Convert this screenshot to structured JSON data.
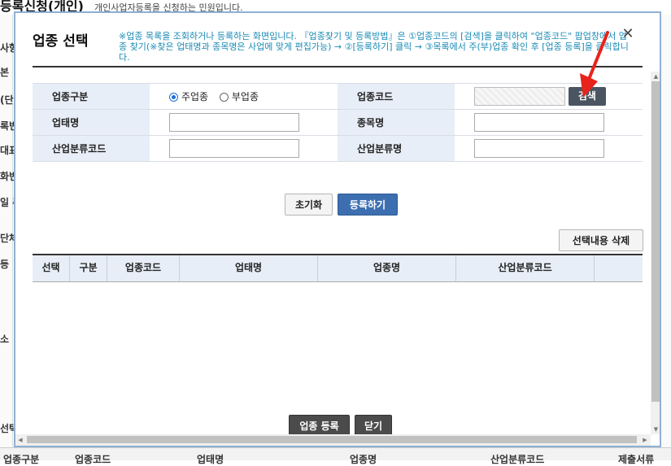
{
  "background": {
    "title": "등록신청(개인)",
    "subtitle": "개인사업자등록을 신청하는 민원입니다.",
    "left_labels": [
      "사항",
      "본",
      "(단",
      "록번",
      "대표",
      "화번",
      "일 주",
      "단체",
      "등",
      "소",
      "선택"
    ],
    "bottom_labels": [
      "업종구분",
      "업종코드",
      "업태명",
      "업종명",
      "산업분류코드",
      "제출서류"
    ]
  },
  "modal": {
    "title": "업종 선택",
    "notice": "※업종 목록을 조회하거나 등록하는 화면입니다. 『업종찾기 및 등록방법』은 ①업종코드의 [검색]을 클릭하여 \"업종코드\" 팝업창에서 업종 찾기(※찾은 업태명과 종목명은 사업에 맞게 편집가능) → ②[등록하기] 클릭 → ③목록에서 주(부)업종 확인 후 [업종 등록]을 클릭합니다.",
    "close_icon": "✕",
    "form": {
      "industry_type_label": "업종구분",
      "main_option": "주업종",
      "sub_option": "부업종",
      "selected": "주업종",
      "industry_code_label": "업종코드",
      "search_button": "검색",
      "business_type_label": "업태명",
      "business_type_value": "",
      "item_name_label": "종목명",
      "item_name_value": "",
      "ind_class_code_label": "산업분류코드",
      "ind_class_code_value": "",
      "ind_class_name_label": "산업분류명",
      "ind_class_name_value": ""
    },
    "buttons": {
      "reset": "초기화",
      "register": "등록하기",
      "delete_selected": "선택내용 삭제",
      "submit": "업종 등록",
      "close": "닫기"
    },
    "grid_columns": [
      "선택",
      "구분",
      "업종코드",
      "업태명",
      "업종명",
      "산업분류코드"
    ],
    "grid_rows": []
  },
  "colors": {
    "accent_blue": "#3d6fb0",
    "notice": "#1a8bb5",
    "header_bg": "#e8eef7",
    "annotation_arrow": "#e8231c"
  }
}
